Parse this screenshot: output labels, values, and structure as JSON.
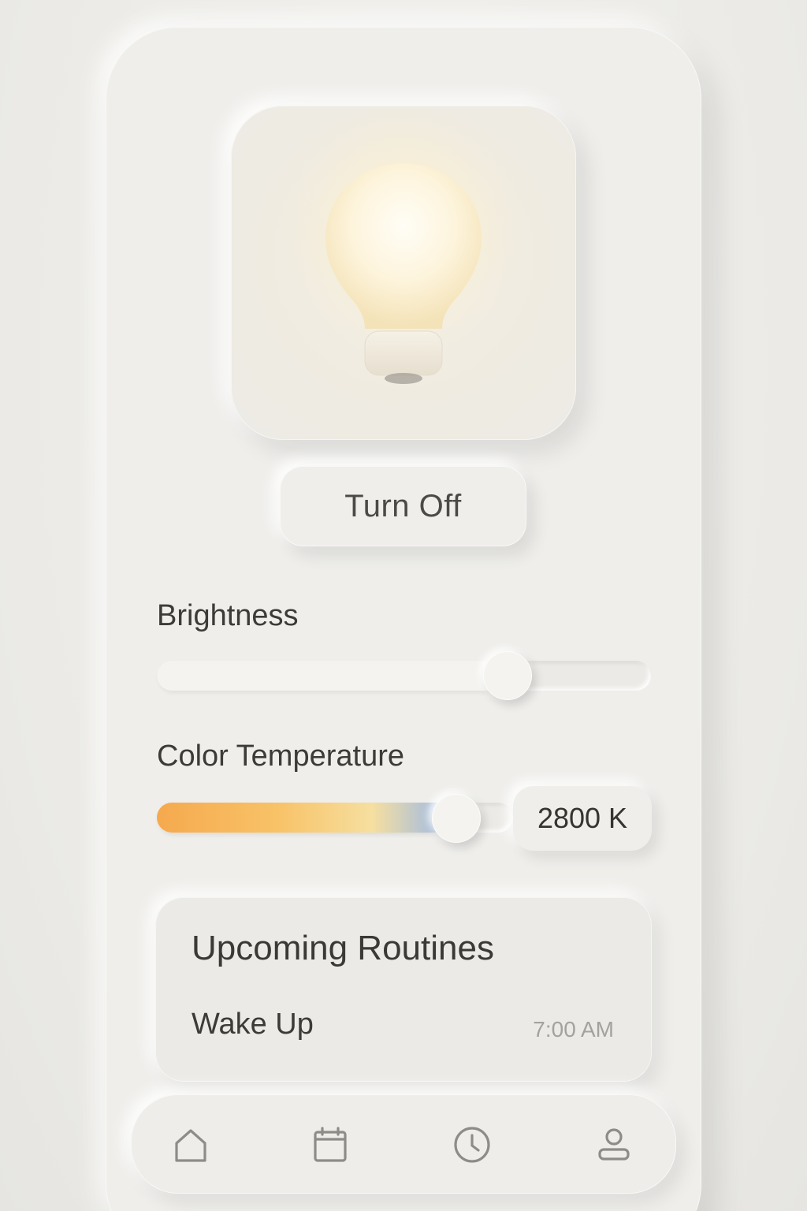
{
  "light_control": {
    "power_button_label": "Turn Off",
    "brightness": {
      "label": "Brightness",
      "value_fraction": 0.71
    },
    "color_temperature": {
      "label": "Color Temperature",
      "value_fraction": 0.84,
      "display_value": "2800 K"
    }
  },
  "routines": {
    "title": "Upcoming Routines",
    "items": [
      {
        "name": "Wake Up",
        "time": "7:00 AM"
      }
    ]
  },
  "bottom_nav": {
    "items": [
      {
        "icon": "home-icon"
      },
      {
        "icon": "calendar-icon"
      },
      {
        "icon": "clock-icon"
      },
      {
        "icon": "profile-icon"
      }
    ]
  },
  "colors": {
    "background": "#ebeae6",
    "bulb_glow": "#fff6dc",
    "gradient_warm": "#f6a94e",
    "gradient_cool": "#8eb3f2",
    "text_primary": "#3a3936",
    "text_muted": "#a3a29d"
  }
}
